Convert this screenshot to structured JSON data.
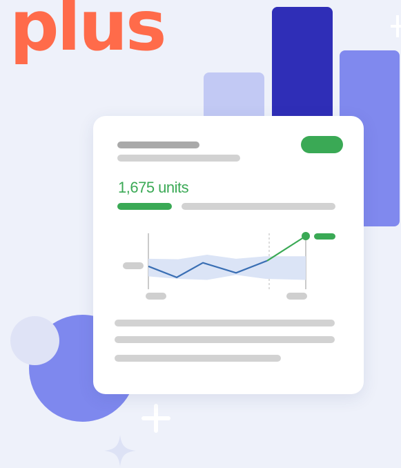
{
  "logo": {
    "text": "plus"
  },
  "card": {
    "value_text": "1,675 units"
  },
  "colors": {
    "logo": "#ff6b4a",
    "accent_green": "#3aa955",
    "bar_light": "#c2c9f4",
    "bar_dark": "#2f2eb7",
    "bar_mid": "#8089ee",
    "circle_big": "#7e88ee",
    "circle_small": "#dfe3f6",
    "placeholder_dark": "#a9a9a9",
    "placeholder": "#cfcfcf",
    "chart_line": "#3a6fb4",
    "chart_band": "#dbe4f6"
  },
  "icons": [
    "plus-sparkle-icon",
    "four-point-star-icon"
  ],
  "chart_data": {
    "type": "line",
    "series": [
      {
        "values": [
          0.4,
          0.18,
          0.47,
          0.27,
          0.51
        ]
      },
      {
        "values": [
          0.51,
          1.0
        ]
      }
    ],
    "band": {
      "upper": [
        0.55,
        0.54,
        0.63,
        0.55,
        0.6,
        0.6
      ],
      "lower": [
        0.2,
        0.15,
        0.13,
        0.23,
        0.15,
        0.13
      ]
    }
  }
}
